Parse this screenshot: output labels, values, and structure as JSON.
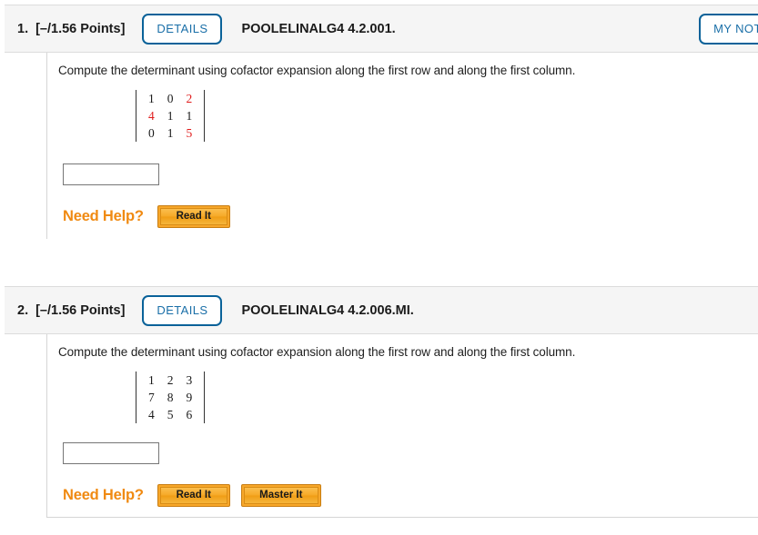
{
  "questions": [
    {
      "number": "1.",
      "points": "[–/1.56 Points]",
      "details_label": "DETAILS",
      "code": "POOLELINALG4 4.2.001.",
      "my_notes_label": "MY NOTES",
      "prompt": "Compute the determinant using cofactor expansion along the first row and along the first column.",
      "matrix": {
        "rows": [
          [
            {
              "v": "1",
              "color": "black"
            },
            {
              "v": "0",
              "color": "black"
            },
            {
              "v": "2",
              "color": "red"
            }
          ],
          [
            {
              "v": "4",
              "color": "red"
            },
            {
              "v": "1",
              "color": "black"
            },
            {
              "v": "1",
              "color": "black"
            }
          ],
          [
            {
              "v": "0",
              "color": "black"
            },
            {
              "v": "1",
              "color": "black"
            },
            {
              "v": "5",
              "color": "red"
            }
          ]
        ]
      },
      "answer_value": "",
      "answer_placeholder": "",
      "need_help_label": "Need Help?",
      "help_buttons": [
        "Read It"
      ]
    },
    {
      "number": "2.",
      "points": "[–/1.56 Points]",
      "details_label": "DETAILS",
      "code": "POOLELINALG4 4.2.006.MI.",
      "my_notes_label": "",
      "prompt": "Compute the determinant using cofactor expansion along the first row and along the first column.",
      "matrix": {
        "rows": [
          [
            {
              "v": "1",
              "color": "black"
            },
            {
              "v": "2",
              "color": "black"
            },
            {
              "v": "3",
              "color": "black"
            }
          ],
          [
            {
              "v": "7",
              "color": "black"
            },
            {
              "v": "8",
              "color": "black"
            },
            {
              "v": "9",
              "color": "black"
            }
          ],
          [
            {
              "v": "4",
              "color": "black"
            },
            {
              "v": "5",
              "color": "black"
            },
            {
              "v": "6",
              "color": "black"
            }
          ]
        ]
      },
      "answer_value": "",
      "answer_placeholder": "",
      "need_help_label": "Need Help?",
      "help_buttons": [
        "Read It",
        "Master It"
      ]
    }
  ],
  "colors": {
    "accent_blue": "#0a6299",
    "help_orange": "#f08a12",
    "matrix_red": "#e01b1b",
    "header_bg": "#f5f5f5",
    "border": "#d5d5d5"
  }
}
